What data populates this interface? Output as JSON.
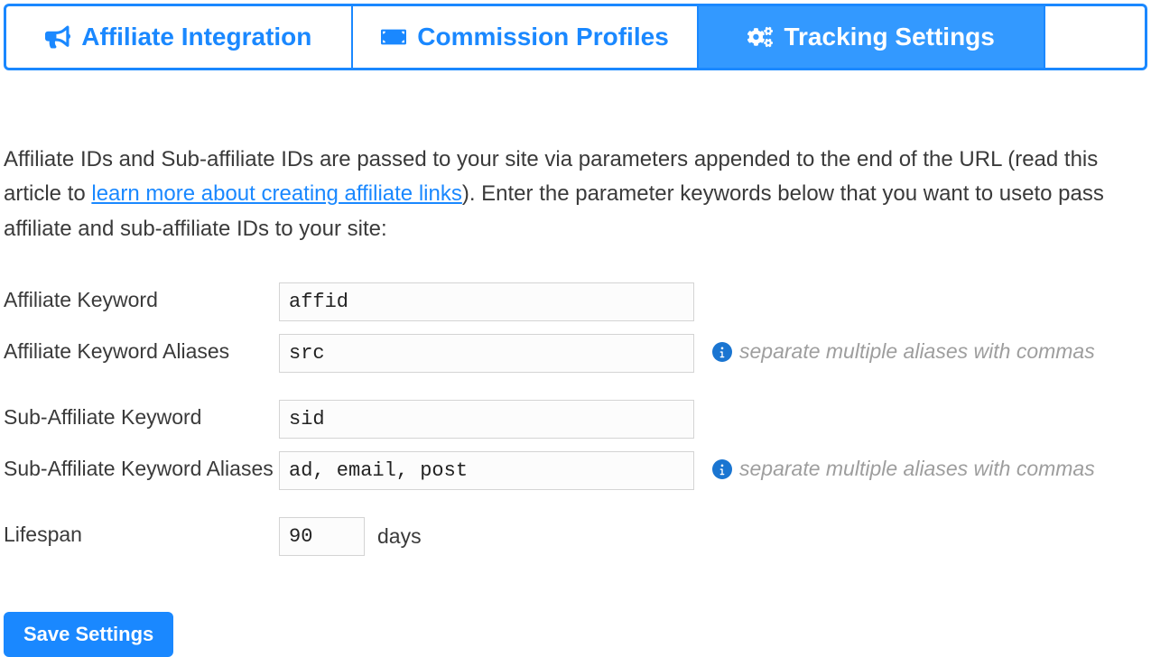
{
  "tabs": [
    {
      "label": "Affiliate Integration"
    },
    {
      "label": "Commission Profiles"
    },
    {
      "label": "Tracking Settings"
    }
  ],
  "intro": {
    "part1": "Affiliate IDs and Sub-affiliate IDs are passed to your site via parameters appended to the end of the URL (read this article to ",
    "link": "learn more about creating affiliate links",
    "part2": "). Enter the parameter keywords below that you want to useto pass affiliate and sub-affiliate IDs to your site:"
  },
  "form": {
    "affiliate_keyword": {
      "label": "Affiliate Keyword",
      "value": "affid"
    },
    "affiliate_aliases": {
      "label": "Affiliate Keyword Aliases",
      "value": "src",
      "hint": "separate multiple aliases with commas"
    },
    "sub_keyword": {
      "label": "Sub-Affiliate Keyword",
      "value": "sid"
    },
    "sub_aliases": {
      "label": "Sub-Affiliate Keyword Aliases",
      "value": "ad, email, post",
      "hint": "separate multiple aliases with commas"
    },
    "lifespan": {
      "label": "Lifespan",
      "value": "90",
      "unit": "days"
    }
  },
  "buttons": {
    "save": "Save Settings"
  }
}
